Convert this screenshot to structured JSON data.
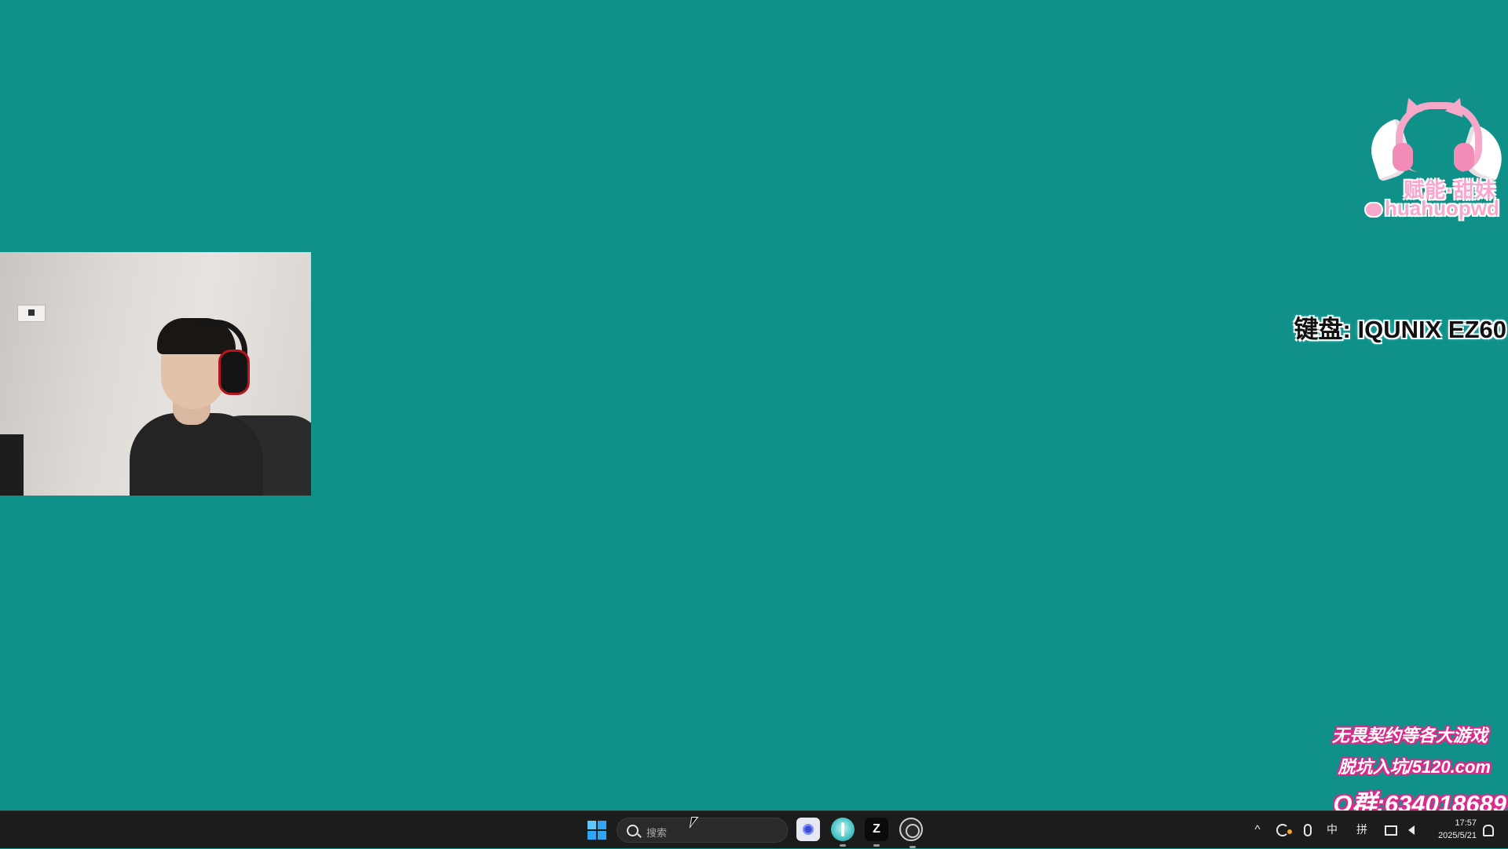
{
  "overlay": {
    "logo": {
      "brand": "赋能·甜妹",
      "handle": "huahuopwd",
      "icon": "wechat-icon",
      "colors": {
        "pink": "#f7a8cc",
        "outline": "#ffffff"
      }
    },
    "keyboard_caption": "键盘: IQUNIX EZ60",
    "promo": {
      "line1": "无畏契约等各大游戏",
      "line2": "脱坑入坑/5120.com",
      "line3": "Q群:634018689",
      "outline_color": "#e0288a"
    },
    "webcam": {
      "description_icon": "webcam-feed"
    }
  },
  "desktop": {
    "background_color": "#0f9088"
  },
  "taskbar": {
    "start_icon": "windows-start-icon",
    "search": {
      "placeholder": "搜索",
      "icon": "search-icon"
    },
    "pinned_apps": [
      {
        "name": "app-blue-circle-icon",
        "running": false
      },
      {
        "name": "app-teal-figure-icon",
        "running": true
      },
      {
        "name": "app-z-icon",
        "label": "Z",
        "running": true
      },
      {
        "name": "obs-icon",
        "running": true
      }
    ],
    "tray": {
      "chevron": "^",
      "ime_mode": "中",
      "ime_layout": "拼",
      "time": "17:57",
      "date": "2025/5/21"
    }
  }
}
